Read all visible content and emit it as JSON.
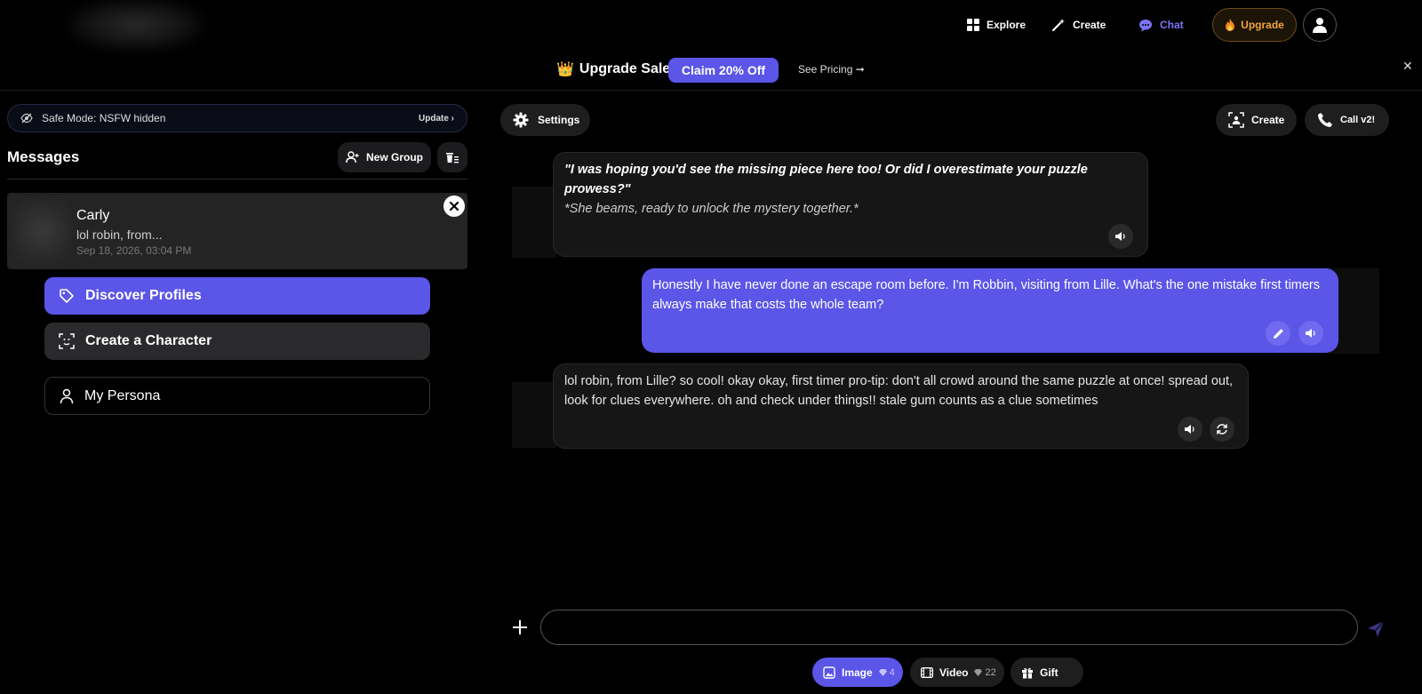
{
  "nav": {
    "explore": "Explore",
    "create": "Create",
    "chat": "Chat",
    "upgrade": "Upgrade"
  },
  "promo": {
    "emoji": "👑",
    "title": "Upgrade Sale",
    "claim": "Claim 20% Off",
    "see_pricing": "See Pricing ➞",
    "close": "✕"
  },
  "sidebar": {
    "safe_mode": "Safe Mode: NSFW hidden",
    "update": "Update ›",
    "messages_title": "Messages",
    "new_group": "New Group",
    "conversation": {
      "name": "Carly",
      "preview": "lol robin, from...",
      "time": "Sep 18, 2026, 03:04 PM"
    },
    "discover": "Discover Profiles",
    "create_character": "Create a Character",
    "persona": "My Persona"
  },
  "chat_header": {
    "settings": "Settings",
    "create": "Create",
    "call": "Call v2!"
  },
  "messages": [
    {
      "role": "ai",
      "line1": "\"I was hoping you'd see the missing piece here too! Or did I overestimate your puzzle prowess?\"",
      "line2": "*She beams, ready to unlock the mystery together.*"
    },
    {
      "role": "user",
      "text": "Honestly I have never done an escape room before. I'm Robbin, visiting from Lille. What's the one mistake first timers always make that costs the whole team?"
    },
    {
      "role": "ai",
      "text": "lol robin, from Lille? so cool! okay okay, first timer pro-tip: don't all crowd around the same puzzle at once! spread out, look for clues everywhere. oh and check under things!! stale gum counts as a clue sometimes"
    }
  ],
  "composer": {
    "placeholder": "",
    "image": "Image",
    "image_cost": "4",
    "video": "Video",
    "video_cost": "22",
    "gift": "Gift"
  },
  "colors": {
    "accent": "#5b55e8",
    "upgrade": "#f0a33a",
    "chat_active": "#7b74f5"
  }
}
